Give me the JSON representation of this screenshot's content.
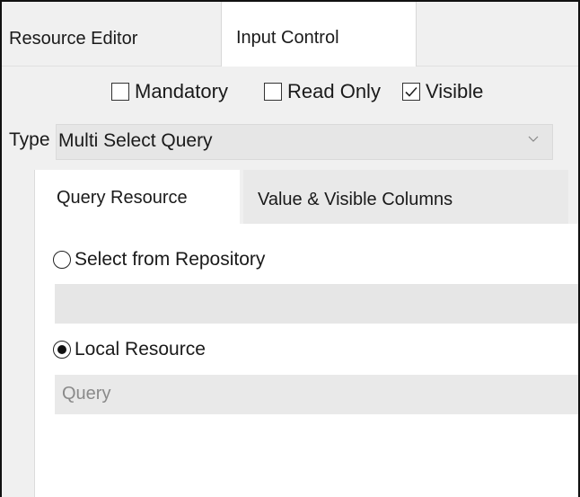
{
  "tabs": {
    "resource_editor": "Resource Editor",
    "input_control": "Input Control"
  },
  "options": {
    "mandatory": {
      "label": "Mandatory",
      "checked": false
    },
    "read_only": {
      "label": "Read Only",
      "checked": false
    },
    "visible": {
      "label": "Visible",
      "checked": true
    }
  },
  "type": {
    "label": "Type",
    "value": "Multi Select Query"
  },
  "sub_tabs": {
    "query_resource": "Query Resource",
    "value_visible_columns": "Value & Visible Columns"
  },
  "source": {
    "repository_label": "Select from Repository",
    "repository_selected": false,
    "repository_value": "",
    "local_label": "Local Resource",
    "local_selected": true,
    "local_placeholder": "Query"
  },
  "icons": {
    "dropdown": "chevron-down-icon",
    "check": "checkmark-icon"
  }
}
